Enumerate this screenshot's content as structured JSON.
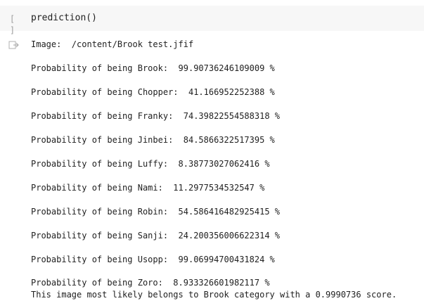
{
  "code_cell": {
    "run_indicator": "[ ]",
    "code": "prediction()"
  },
  "output": {
    "image_line": "Image:  /content/Brook test.jfif",
    "probabilities": [
      "Probability of being Brook:  99.90736246109009 %",
      "Probability of being Chopper:  41.166952252388 %",
      "Probability of being Franky:  74.39822554588318 %",
      "Probability of being Jinbei:  84.5866322517395 %",
      "Probability of being Luffy:  8.38773027062416 %",
      "Probability of being Nami:  11.2977534532547 %",
      "Probability of being Robin:  54.586416482925415 %",
      "Probability of being Sanji:  24.200356006622314 %",
      "Probability of being Usopp:  99.06994700431824 %",
      "Probability of being Zoro:  8.933326601982117 %"
    ],
    "conclusion": "This image most likely belongs to Brook category with a 0.9990736 score."
  }
}
